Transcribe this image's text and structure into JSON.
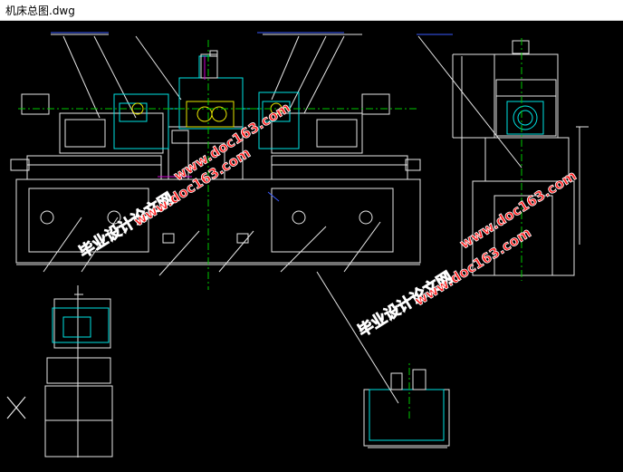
{
  "window": {
    "title": "机床总图.dwg"
  },
  "watermark": {
    "cn_text": "毕业设计论文网",
    "url_text": "www.doc163.com",
    "fill_color": "#ff1e1e",
    "stroke_color": "#ffffff"
  },
  "colors": {
    "white_line": "#e6e6e6",
    "cyan_line": "#00e5e5",
    "yellow_line": "#e6e600",
    "green_center": "#00c800",
    "blue_dim": "#3a5aff",
    "magenta_line": "#d000d0"
  },
  "icons": {
    "axis_cross": "ucs-cross-icon"
  }
}
